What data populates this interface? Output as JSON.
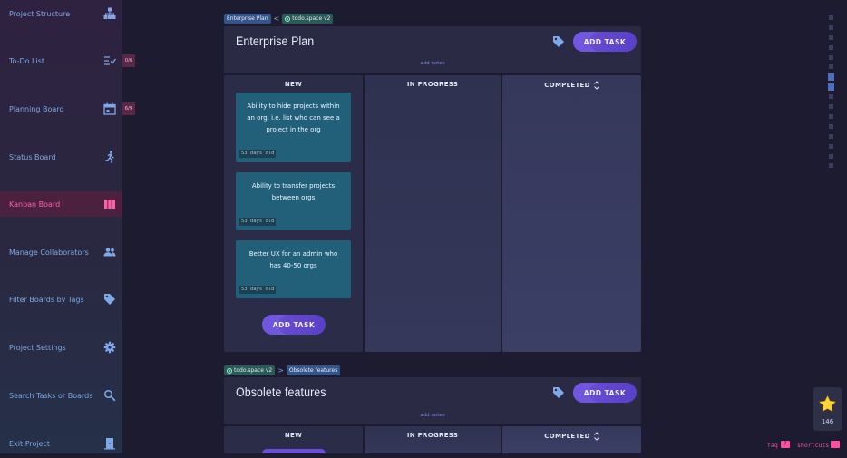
{
  "sidebar": {
    "items": [
      {
        "label": "Project Structure",
        "icon": "sitemap-icon"
      },
      {
        "label": "To-Do List",
        "icon": "checklist-icon",
        "badge": "0/6"
      },
      {
        "label": "Planning Board",
        "icon": "calendar-icon",
        "badge": "6/9"
      },
      {
        "label": "Status Board",
        "icon": "running-person-icon"
      },
      {
        "label": "Kanban Board",
        "icon": "columns-icon",
        "active": true
      },
      {
        "label": "Manage Collaborators",
        "icon": "users-icon"
      },
      {
        "label": "Filter Boards by Tags",
        "icon": "tag-icon"
      },
      {
        "label": "Project Settings",
        "icon": "gear-icon"
      },
      {
        "label": "Search Tasks or Boards",
        "icon": "search-icon"
      },
      {
        "label": "Exit Project",
        "icon": "exit-door-icon"
      }
    ]
  },
  "boards": [
    {
      "crumbs": [
        {
          "label": "Enterprise Plan",
          "style": "blue"
        },
        {
          "label": "todo.space v2",
          "style": "green"
        }
      ],
      "crumb_sep": "<",
      "title": "Enterprise Plan",
      "add_task": "ADD TASK",
      "add_notes": "add notes",
      "columns": [
        "NEW",
        "IN PROGRESS",
        "COMPLETED"
      ],
      "cards": [
        {
          "text": "Ability to hide projects within an org, i.e. list who can see a project in the org",
          "age": "53 days old"
        },
        {
          "text": "Ability to transfer projects between orgs",
          "age": "53 days old"
        },
        {
          "text": "Better UX for an admin who has 40-50 orgs",
          "age": "53 days old"
        }
      ],
      "column_add_task": "ADD TASK"
    },
    {
      "crumbs": [
        {
          "label": "todo.space v2",
          "style": "green"
        },
        {
          "label": "Obsolete features",
          "style": "blue"
        }
      ],
      "crumb_sep": ">",
      "title": "Obsolete features",
      "add_task": "ADD TASK",
      "add_notes": "add notes",
      "columns": [
        "NEW",
        "IN PROGRESS",
        "COMPLETED"
      ]
    }
  ],
  "stars": {
    "count": "146"
  },
  "footer": {
    "faq": "faq",
    "faq_badge": "?",
    "shortcuts": "shortcuts"
  },
  "colors": {
    "accent": "#6b4fd8",
    "active_nav": "#ff5fa8",
    "card": "#22607a"
  }
}
